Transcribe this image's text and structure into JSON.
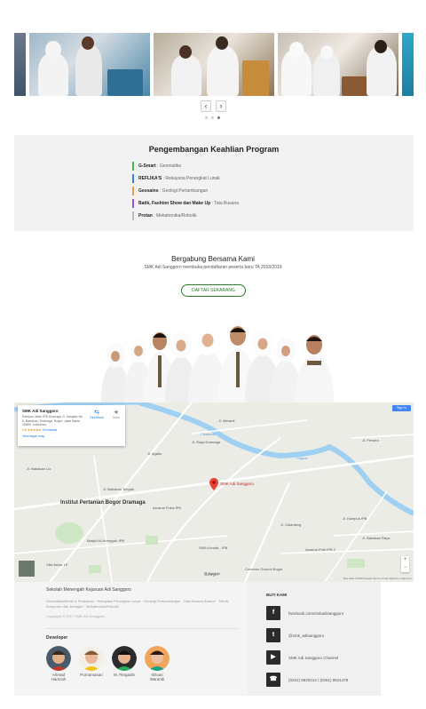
{
  "carousel": {
    "prev_label": "‹",
    "next_label": "›",
    "slide_count": 3,
    "active_index": 2
  },
  "program": {
    "title": "Pengembangan Keahlian Program",
    "items": [
      {
        "name": "G-Smart",
        "desc": ": Geomatika",
        "color": "#4caf50"
      },
      {
        "name": "REFLIKA'S",
        "desc": ": Rekayasa Perangkat Lunak",
        "color": "#2f80ed"
      },
      {
        "name": "Geosains",
        "desc": ": Geologi Pertambangan",
        "color": "#f2994a"
      },
      {
        "name": "Batik, Fashion Show dan Make Up",
        "desc": ": Tata Busana",
        "color": "#9b51e0"
      },
      {
        "name": "Protan",
        "desc": ": Mekatronika/Robotik",
        "color": "#bdbdbd"
      }
    ]
  },
  "join": {
    "title": "Bergabung Bersama Kami",
    "subtitle": "SMK Adi Sanggoro membuka pendaftaran peserta baru TA 2018/2019",
    "button_label": "DAFTAR SEKARANG"
  },
  "map": {
    "place_name": "SMK Adi Sanggoro",
    "address": "Kampus Jalan IPB Dramaga Jl. Sangkar No 6, Babakan, Dramaga, Bogor, Jawa Barat 16680, Indonesia",
    "rating": "4.6 ★★★★★",
    "reviews": "29 reviews",
    "view_larger": "View larger map",
    "directions": "Directions",
    "save": "Save",
    "sign_in": "Sign in",
    "marker_label": "SMK Adi Sanggoro",
    "labels": {
      "institut": "Institut Pertanian Bogor Dramaga",
      "asrama": "Asrama Putra IPB",
      "sma": "SMA Kornita - IPB",
      "masjid": "Masjid Al-Hurriyyah IPB",
      "common": "Common Ground Bogor",
      "asrama2": "Asrama Putri IPB 2",
      "alhurr": "Villa Anisa 1E",
      "cisadane": "Cisadane",
      "ciapus": "Ciapus",
      "jalan1": "Jl. Babakan Lio",
      "jalan2": "Jl. Raya Dramaga",
      "jalan3": "Jl. Meranti",
      "jalan4": "Jl. Agatis",
      "jalan5": "Jl. Babakan Tengah",
      "jalan6": "Jl. Perwira",
      "jalan7": "Jl. Cibanteng",
      "jalan8": "Jl. Bara IV",
      "jalan9": "Jl. Kampus IPB",
      "jalan10": "Jl. Babakan Raya"
    },
    "google_label": "Google",
    "attribution": "Map data ©2018 Google  Terms of Use  Report a map error",
    "zoom_in": "+",
    "zoom_out": "−"
  },
  "footer": {
    "title": "Sekolah Menengah Kejuruan Adi Sanggoro",
    "text": "Geomatika/Nenhi & Perikanan · Rekayasa Perangkat Lunak · Geologi Pertambangan · Tata Busana Butane · Teknik Komputer dan Jaringan · Mekatronika/Robotik",
    "copyright": "Copyright © 2017 SMK Adi Sanggoro",
    "developer_title": "Developer",
    "developers": [
      {
        "name": "Ahmad Hamzah",
        "color": "#4a5a6a"
      },
      {
        "name": "Purnamasari",
        "color": "#f3efe6"
      },
      {
        "name": "M. Ringadin",
        "color": "#2c2c2c"
      },
      {
        "name": "Ikhsan Warandi",
        "color": "#f0a45c"
      }
    ],
    "contact_title": "BUTI KAMI",
    "social": [
      {
        "icon": "f",
        "text": "facebook.com/smkadisanggoro"
      },
      {
        "icon": "t",
        "text": "@smk_adisanggoro"
      },
      {
        "icon": "▶",
        "text": "SMK Adi Sanggoro Channel"
      },
      {
        "icon": "☎",
        "text": "(0251) 8620214 / (0251) 8621478"
      }
    ]
  }
}
